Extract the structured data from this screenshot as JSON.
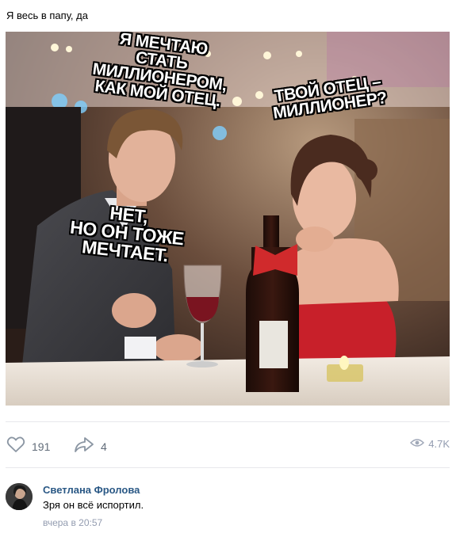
{
  "post": {
    "caption": "Я весь в папу, да",
    "meme": {
      "bubble_top_left": "Я МЕЧТАЮ СТАТЬ\nМИЛЛИОНЕРОМ,\nКАК МОЙ ОТЕЦ.",
      "bubble_top_right": "ТВОЙ ОТЕЦ –\nМИЛЛИОНЕР?",
      "bubble_middle": "НЕТ,\nНО ОН ТОЖЕ\nМЕЧТАЕТ."
    },
    "likes": "191",
    "shares": "4",
    "views": "4.7K"
  },
  "comment": {
    "author": "Светлана Фролова",
    "text": "Зря он всё испортил.",
    "time": "вчера в 20:57"
  },
  "colors": {
    "link": "#2a5885",
    "muted": "#939cb0",
    "action": "#626d7a",
    "dress": "#c8202a"
  },
  "icons": [
    "heart-icon",
    "share-arrow-icon",
    "eye-icon"
  ]
}
